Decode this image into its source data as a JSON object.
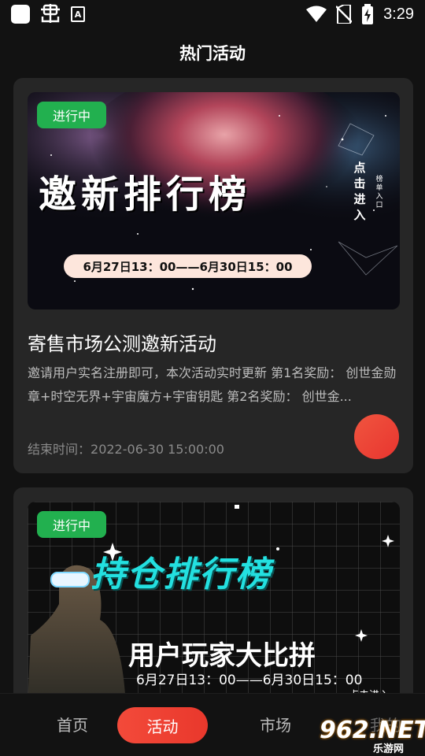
{
  "status_bar": {
    "time": "3:29",
    "icons": [
      "app-square-icon",
      "bug-icon",
      "a-badge-icon",
      "wifi-icon",
      "no-sim-icon",
      "battery-charging-icon"
    ],
    "a_glyph": "A"
  },
  "header": {
    "title": "热门活动"
  },
  "activities": [
    {
      "status_badge": "进行中",
      "banner_title": "邀新排行榜",
      "banner_side_text": "点击进入",
      "banner_side_small": "榜单入口",
      "banner_date": "6月27日13：00——6月30日15：00",
      "title": "寄售市场公测邀新活动",
      "description": "邀请用户实名注册即可，本次活动实时更新 第1名奖励： 创世金勋章+时空无界+宇宙魔方+宇宙钥匙 第2名奖励： 创世金...",
      "end_label": "结束时间：",
      "end_time": "2022-06-30 15:00:00"
    },
    {
      "status_badge": "进行中",
      "banner_title": "持仓排行榜",
      "banner_subtitle": "用户玩家大比拼",
      "banner_date": "6月27日13：00——6月30日15：00",
      "banner_corner_text": "点击进入"
    }
  ],
  "bottom_nav": {
    "items": [
      "首页",
      "活动",
      "市场",
      "我的"
    ],
    "active": "活动"
  },
  "watermark": {
    "text": "962.NET",
    "sub": "乐游网"
  },
  "colors": {
    "background": "#121212",
    "card": "#262626",
    "badge_green": "#22b04f",
    "accent_red": "#ef4637",
    "cyan_title": "#23e0e0"
  }
}
